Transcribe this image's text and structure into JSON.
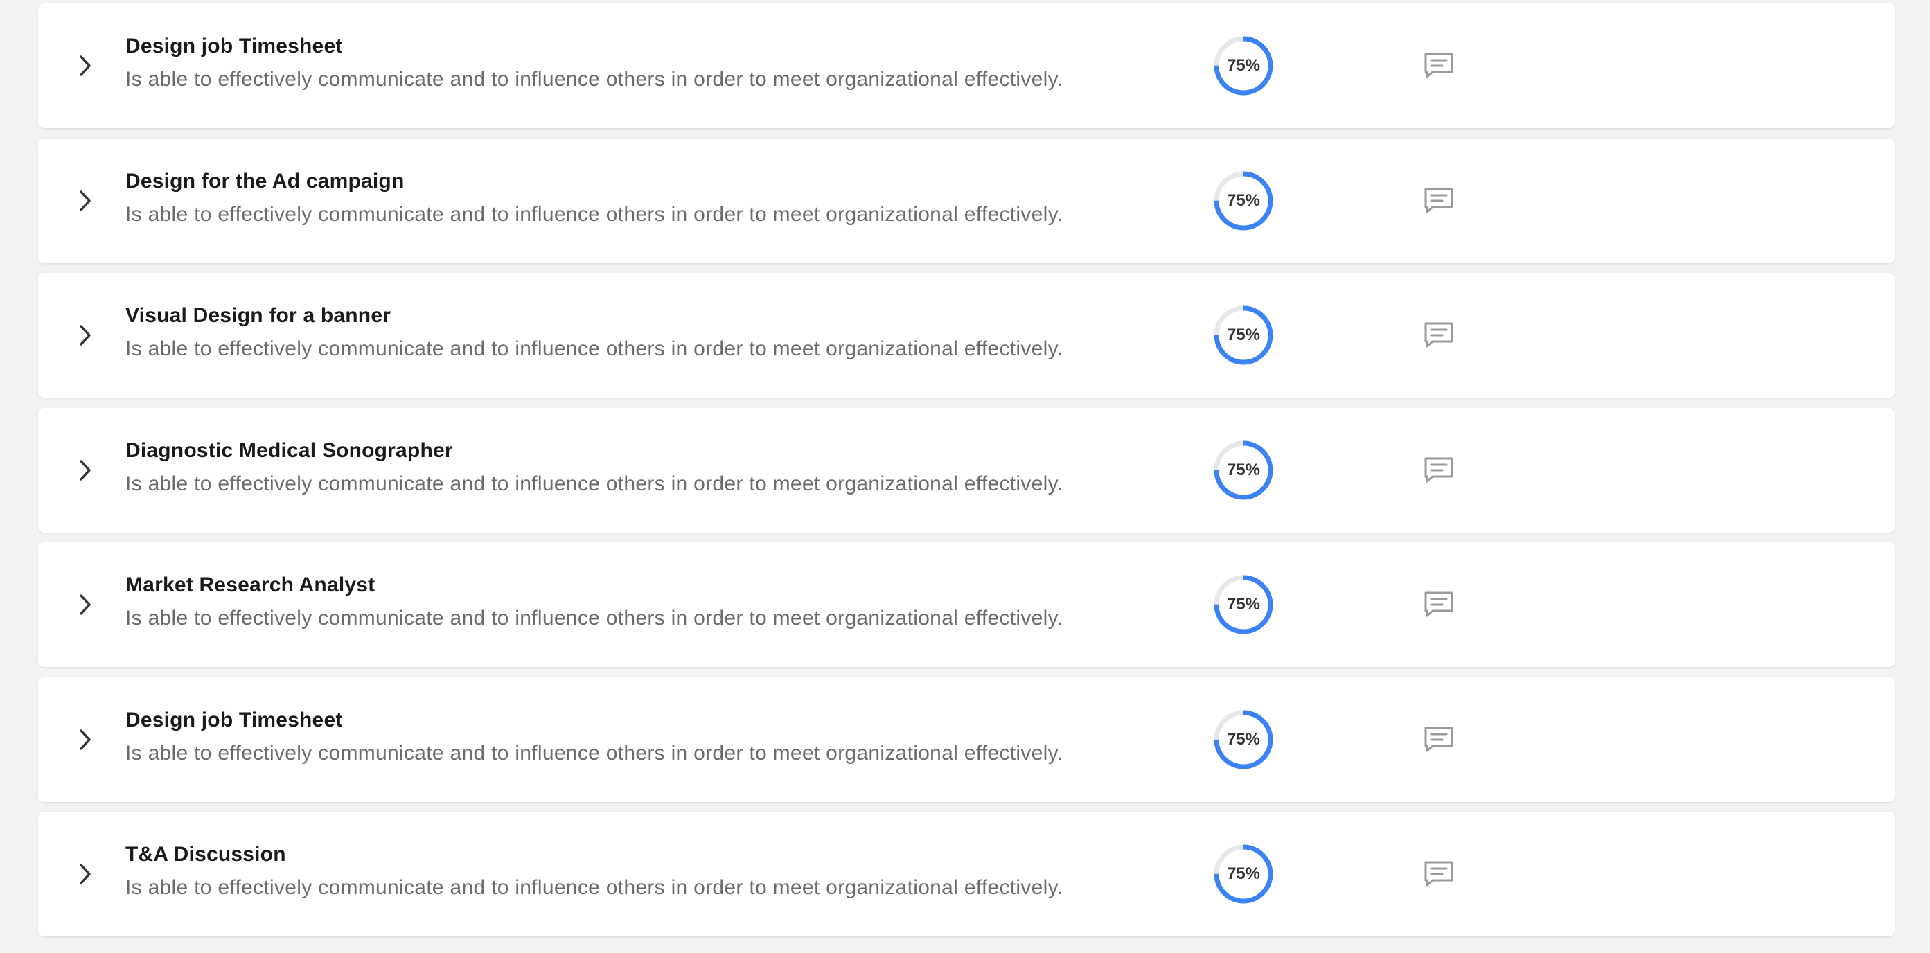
{
  "colors": {
    "accent": "#3b82f6",
    "track": "#e5e7eb",
    "title": "#1a1a1a",
    "subtitle": "#6b6b6b",
    "icon": "#9a9a9a"
  },
  "items": [
    {
      "title": "Design job Timesheet",
      "description": "Is able to effectively communicate and to influence others in order to meet organizational effectively.",
      "progress_label": "75%",
      "progress": 0.75,
      "expand_icon": "chevron-right-icon",
      "comment_icon": "comment-icon"
    },
    {
      "title": "Design for the Ad campaign",
      "description": "Is able to effectively communicate and to influence others in order to meet organizational effectively.",
      "progress_label": "75%",
      "progress": 0.75,
      "expand_icon": "chevron-right-icon",
      "comment_icon": "comment-icon"
    },
    {
      "title": "Visual Design for a banner",
      "description": "Is able to effectively communicate and to influence others in order to meet organizational effectively.",
      "progress_label": "75%",
      "progress": 0.75,
      "expand_icon": "chevron-right-icon",
      "comment_icon": "comment-icon"
    },
    {
      "title": "Diagnostic Medical Sonographer",
      "description": "Is able to effectively communicate and to influence others in order to meet organizational effectively.",
      "progress_label": "75%",
      "progress": 0.75,
      "expand_icon": "chevron-right-icon",
      "comment_icon": "comment-icon"
    },
    {
      "title": "Market Research Analyst",
      "description": "Is able to effectively communicate and to influence others in order to meet organizational effectively.",
      "progress_label": "75%",
      "progress": 0.75,
      "expand_icon": "chevron-right-icon",
      "comment_icon": "comment-icon"
    },
    {
      "title": "Design job Timesheet",
      "description": "Is able to effectively communicate and to influence others in order to meet organizational effectively.",
      "progress_label": "75%",
      "progress": 0.75,
      "expand_icon": "chevron-right-icon",
      "comment_icon": "comment-icon"
    },
    {
      "title": "T&A Discussion",
      "description": "Is able to effectively communicate and to influence others in order to meet organizational effectively.",
      "progress_label": "75%",
      "progress": 0.75,
      "expand_icon": "chevron-right-icon",
      "comment_icon": "comment-icon"
    }
  ]
}
